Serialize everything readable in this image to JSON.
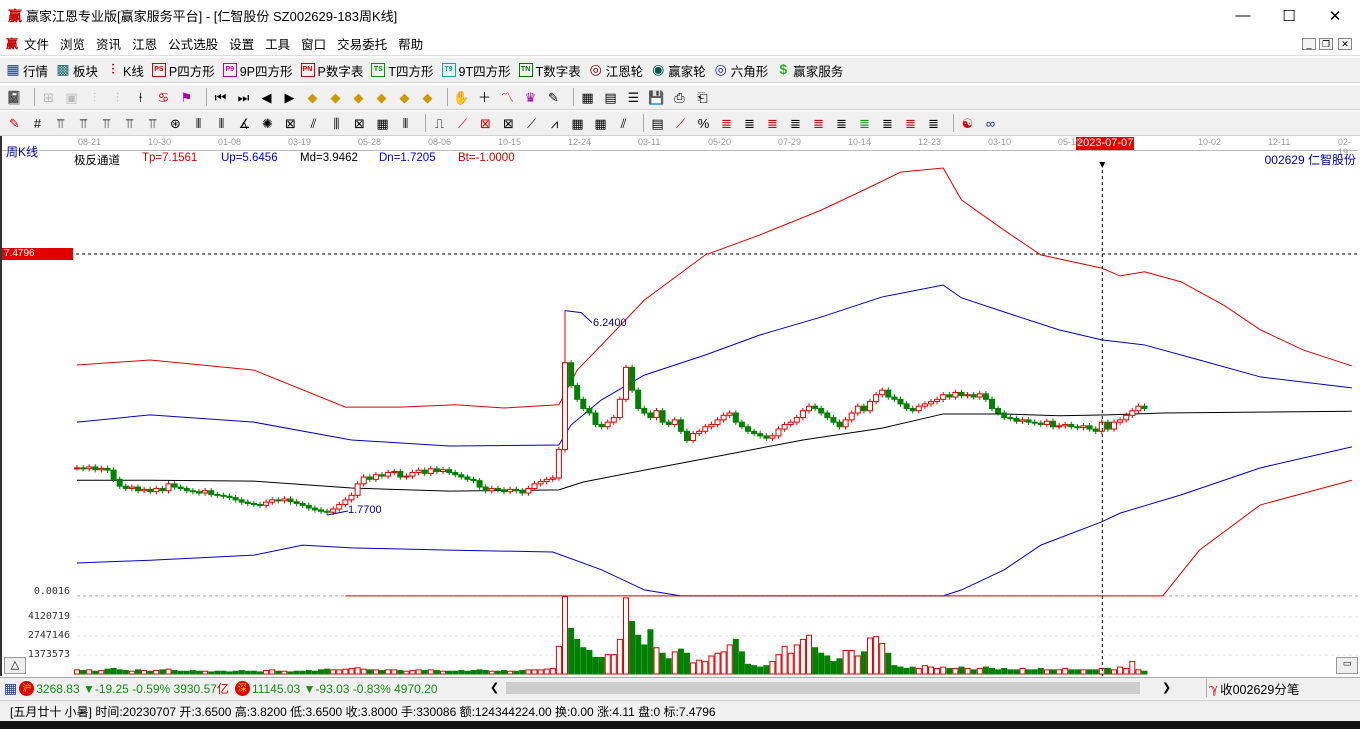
{
  "window": {
    "logo": "赢",
    "title": "赢家江恩专业版[赢家服务平台] - [仁智股份  SZ002629-183周K线]",
    "minimize": "—",
    "maximize": "☐",
    "close": "✕"
  },
  "menu": [
    "文件",
    "浏览",
    "资讯",
    "江恩",
    "公式选股",
    "设置",
    "工具",
    "窗口",
    "交易委托",
    "帮助"
  ],
  "toolbar1": [
    {
      "icon": "grid-icon",
      "glyph": "▦",
      "label": "行情",
      "color": "#1a3a8a"
    },
    {
      "icon": "blocks-icon",
      "glyph": "▩",
      "label": "板块",
      "color": "#1a6a6a"
    },
    {
      "icon": "kline-icon",
      "glyph": "⫶",
      "label": "K线",
      "color": "#c00"
    },
    {
      "icon": "ps-icon",
      "glyph": "PS",
      "label": "P四方形",
      "color": "#c00"
    },
    {
      "icon": "p9-icon",
      "glyph": "P9",
      "label": "9P四方形",
      "color": "#b0b"
    },
    {
      "icon": "pn-icon",
      "glyph": "PN",
      "label": "P数字表",
      "color": "#c00"
    },
    {
      "icon": "ts-icon",
      "glyph": "TS",
      "label": "T四方形",
      "color": "#090"
    },
    {
      "icon": "t9-icon",
      "glyph": "T9",
      "label": "9T四方形",
      "color": "#0aa"
    },
    {
      "icon": "tn-icon",
      "glyph": "TN",
      "label": "T数字表",
      "color": "#070"
    },
    {
      "icon": "gann-wheel-icon",
      "glyph": "◎",
      "label": "江恩轮",
      "color": "#700"
    },
    {
      "icon": "winner-wheel-icon",
      "glyph": "◉",
      "label": "赢家轮",
      "color": "#055"
    },
    {
      "icon": "hexagon-icon",
      "glyph": "◎",
      "label": "六角形",
      "color": "#22a"
    },
    {
      "icon": "dollar-icon",
      "glyph": "$",
      "label": "赢家服务",
      "color": "#3a3"
    }
  ],
  "chart": {
    "period_label": "周K线",
    "indicator": {
      "name": "极反通道",
      "tp": "Tp=7.1561",
      "up": "Up=5.6456",
      "md": "Md=3.9462",
      "dn": "Dn=1.7205",
      "bt": "Bt=-1.0000"
    },
    "stock": "002629  仁智股份",
    "price_marker": "7.4796",
    "crosshair_date": "2023-07-07",
    "high_label": "6.2400",
    "low_label": "1.7700",
    "volume_labels": [
      "0.0016",
      "4120719",
      "2747146",
      "1373573"
    ],
    "up_arrow": "△"
  },
  "chart_data": {
    "type": "candlestick",
    "date_ticks": [
      "08-21",
      "10-30",
      "01-08",
      "03-19",
      "05-28",
      "08-06",
      "10-15",
      "12-24",
      "03-11",
      "05-20",
      "07-29",
      "10-14",
      "12-23",
      "03-10",
      "05-19",
      "07-07",
      "10-02",
      "12-11",
      "02-19"
    ],
    "price_marker": 7.4796,
    "crosshair_index": 168,
    "high": {
      "index": 80,
      "value": 6.24
    },
    "low": {
      "index": 41,
      "value": 1.77
    },
    "closes": [
      2.8,
      2.78,
      2.82,
      2.76,
      2.79,
      2.75,
      2.55,
      2.4,
      2.35,
      2.38,
      2.3,
      2.33,
      2.28,
      2.35,
      2.3,
      2.45,
      2.38,
      2.35,
      2.3,
      2.28,
      2.25,
      2.3,
      2.22,
      2.2,
      2.18,
      2.15,
      2.1,
      2.05,
      2.02,
      2.0,
      1.98,
      2.05,
      2.1,
      2.08,
      2.12,
      2.06,
      2.02,
      1.98,
      1.92,
      1.88,
      1.85,
      1.83,
      1.9,
      2.0,
      2.1,
      2.2,
      2.45,
      2.6,
      2.55,
      2.65,
      2.62,
      2.7,
      2.72,
      2.6,
      2.62,
      2.7,
      2.75,
      2.68,
      2.78,
      2.72,
      2.76,
      2.7,
      2.65,
      2.6,
      2.55,
      2.52,
      2.38,
      2.3,
      2.35,
      2.32,
      2.28,
      2.33,
      2.3,
      2.25,
      2.35,
      2.45,
      2.5,
      2.55,
      2.58,
      3.2,
      5.1,
      4.6,
      4.3,
      4.1,
      4.0,
      3.75,
      3.7,
      3.8,
      3.9,
      4.3,
      5.0,
      4.5,
      4.1,
      4.0,
      3.9,
      4.05,
      3.8,
      3.75,
      3.85,
      3.6,
      3.4,
      3.55,
      3.6,
      3.7,
      3.75,
      3.85,
      3.95,
      4.0,
      3.8,
      3.7,
      3.6,
      3.55,
      3.5,
      3.45,
      3.5,
      3.65,
      3.75,
      3.8,
      3.9,
      4.05,
      4.15,
      4.1,
      4.0,
      3.9,
      3.8,
      3.7,
      3.85,
      4.0,
      4.15,
      4.05,
      4.25,
      4.4,
      4.5,
      4.35,
      4.3,
      4.2,
      4.1,
      4.05,
      4.15,
      4.2,
      4.25,
      4.3,
      4.4,
      4.35,
      4.45,
      4.38,
      4.4,
      4.35,
      4.42,
      4.3,
      4.1,
      4.0,
      3.9,
      3.88,
      3.82,
      3.85,
      3.8,
      3.78,
      3.75,
      3.82,
      3.7,
      3.72,
      3.75,
      3.7,
      3.68,
      3.72,
      3.65,
      3.6,
      3.8,
      3.65,
      3.8,
      3.85,
      3.95,
      4.05,
      4.15,
      4.1
    ],
    "volume_millions": [
      0.3,
      0.25,
      0.3,
      0.2,
      0.25,
      0.35,
      0.4,
      0.3,
      0.25,
      0.2,
      0.3,
      0.25,
      0.2,
      0.25,
      0.3,
      0.35,
      0.25,
      0.2,
      0.2,
      0.25,
      0.2,
      0.2,
      0.15,
      0.2,
      0.2,
      0.15,
      0.2,
      0.25,
      0.2,
      0.2,
      0.15,
      0.25,
      0.3,
      0.2,
      0.2,
      0.15,
      0.2,
      0.2,
      0.25,
      0.2,
      0.3,
      0.35,
      0.3,
      0.3,
      0.35,
      0.4,
      0.45,
      0.35,
      0.3,
      0.3,
      0.25,
      0.3,
      0.3,
      0.25,
      0.2,
      0.25,
      0.3,
      0.25,
      0.3,
      0.25,
      0.2,
      0.2,
      0.2,
      0.25,
      0.2,
      0.25,
      0.3,
      0.25,
      0.2,
      0.2,
      0.25,
      0.2,
      0.2,
      0.25,
      0.3,
      0.3,
      0.3,
      0.35,
      0.4,
      2.0,
      5.6,
      3.3,
      2.5,
      1.9,
      1.7,
      1.2,
      1.2,
      1.4,
      1.4,
      2.5,
      5.5,
      3.8,
      2.8,
      2.1,
      3.2,
      1.9,
      1.5,
      1.1,
      1.6,
      1.8,
      1.5,
      0.8,
      1.0,
      0.9,
      1.3,
      1.5,
      1.6,
      2.1,
      2.5,
      1.6,
      0.7,
      0.6,
      0.5,
      0.6,
      0.9,
      1.4,
      2.0,
      1.5,
      2.1,
      2.5,
      2.8,
      1.9,
      1.5,
      1.3,
      0.9,
      1.1,
      1.7,
      1.7,
      1.3,
      1.6,
      2.6,
      2.7,
      2.2,
      1.5,
      0.6,
      0.5,
      0.4,
      0.5,
      0.4,
      0.6,
      0.5,
      0.4,
      0.5,
      0.4,
      0.4,
      0.5,
      0.4,
      0.3,
      0.4,
      0.5,
      0.4,
      0.3,
      0.4,
      0.3,
      0.3,
      0.4,
      0.3,
      0.3,
      0.4,
      0.3,
      0.3,
      0.3,
      0.4,
      0.3,
      0.3,
      0.3,
      0.3,
      0.3,
      0.4,
      0.4,
      0.3,
      0.5,
      0.4,
      0.9,
      0.3,
      0.2
    ],
    "lines": [
      {
        "name": "Tp",
        "color": "#e00000",
        "points": [
          [
            0,
            5.05
          ],
          [
            12,
            5.16
          ],
          [
            29,
            4.94
          ],
          [
            44,
            4.13
          ],
          [
            53,
            4.13
          ],
          [
            62,
            4.18
          ],
          [
            70,
            4.11
          ],
          [
            79,
            4.18
          ],
          [
            82,
            4.94
          ],
          [
            86,
            5.49
          ],
          [
            93,
            6.47
          ],
          [
            103,
            7.46
          ],
          [
            112,
            7.9
          ],
          [
            122,
            8.44
          ],
          [
            129,
            8.88
          ],
          [
            135,
            9.27
          ],
          [
            142,
            9.36
          ],
          [
            145,
            8.66
          ],
          [
            152,
            8.0
          ],
          [
            158,
            7.46
          ],
          [
            168,
            7.17
          ],
          [
            171,
            7.0
          ],
          [
            175,
            7.09
          ],
          [
            181,
            6.87
          ],
          [
            188,
            6.36
          ],
          [
            194,
            5.82
          ],
          [
            201,
            5.38
          ],
          [
            209,
            5.03
          ]
        ]
      },
      {
        "name": "Up",
        "color": "#0000d0",
        "points": [
          [
            0,
            3.8
          ],
          [
            12,
            3.96
          ],
          [
            29,
            3.8
          ],
          [
            45,
            3.41
          ],
          [
            61,
            3.28
          ],
          [
            79,
            3.3
          ],
          [
            81,
            3.74
          ],
          [
            86,
            4.29
          ],
          [
            93,
            4.83
          ],
          [
            103,
            5.27
          ],
          [
            112,
            5.71
          ],
          [
            122,
            6.1
          ],
          [
            132,
            6.54
          ],
          [
            142,
            6.8
          ],
          [
            145,
            6.52
          ],
          [
            152,
            6.21
          ],
          [
            161,
            5.82
          ],
          [
            168,
            5.6
          ],
          [
            175,
            5.49
          ],
          [
            184,
            5.16
          ],
          [
            194,
            4.79
          ],
          [
            209,
            4.55
          ]
        ]
      },
      {
        "name": "Md",
        "color": "#000000",
        "points": [
          [
            0,
            2.53
          ],
          [
            12,
            2.53
          ],
          [
            29,
            2.51
          ],
          [
            45,
            2.36
          ],
          [
            61,
            2.29
          ],
          [
            79,
            2.32
          ],
          [
            83,
            2.49
          ],
          [
            93,
            2.75
          ],
          [
            106,
            3.08
          ],
          [
            119,
            3.41
          ],
          [
            132,
            3.67
          ],
          [
            142,
            3.98
          ],
          [
            152,
            3.98
          ],
          [
            161,
            3.94
          ],
          [
            169,
            3.96
          ],
          [
            178,
            4.0
          ],
          [
            209,
            4.04
          ]
        ]
      },
      {
        "name": "Dn",
        "color": "#0000d0",
        "points": [
          [
            0,
            0.72
          ],
          [
            12,
            0.78
          ],
          [
            29,
            0.89
          ],
          [
            37,
            1.11
          ],
          [
            45,
            1.05
          ],
          [
            61,
            1.0
          ],
          [
            78,
            0.96
          ],
          [
            86,
            0.57
          ],
          [
            93,
            0.13
          ],
          [
            99,
            0.0
          ],
          [
            142,
            0.0
          ],
          [
            145,
            0.13
          ],
          [
            152,
            0.57
          ],
          [
            158,
            1.11
          ],
          [
            168,
            1.62
          ],
          [
            171,
            1.81
          ],
          [
            181,
            2.21
          ],
          [
            194,
            2.8
          ],
          [
            209,
            3.26
          ]
        ]
      },
      {
        "name": "Bt",
        "color": "#e00000",
        "points": [
          [
            44,
            0.0
          ],
          [
            178,
            0.0
          ],
          [
            184,
            1.0
          ],
          [
            194,
            1.99
          ],
          [
            209,
            2.53
          ]
        ]
      }
    ]
  },
  "index_bar": {
    "sh_badge": "沪",
    "sh": "3268.83 ▼-19.25 -0.59% 3930.57",
    "sh_unit": "亿",
    "sz_badge": "深",
    "sz": "11145.03 ▼-93.03 -0.83% 4970.20",
    "left_arrow": "❮",
    "right_arrow": "❯",
    "collect": "收002629分笔"
  },
  "status": "[五月廿十 小暑] 时间:20230707 开:3.6500 高:3.8200 低:3.6500 收:3.8000 手:330086 额:124344224.00 换:0.00 涨:4.11 盘:0 标:7.4796"
}
